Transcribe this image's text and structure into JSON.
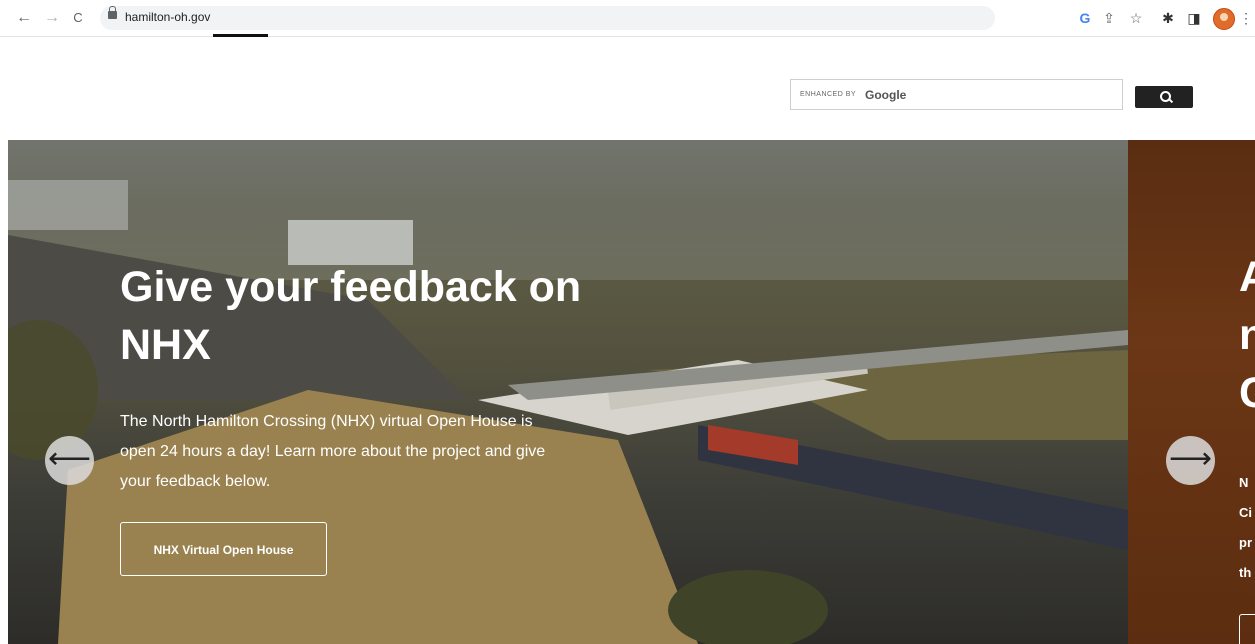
{
  "browser": {
    "url": "hamilton-oh.gov",
    "back_glyph": "←",
    "forward_glyph": "→",
    "reload_glyph": "C",
    "toolbar_icons": [
      "google-icon",
      "share-icon",
      "star-icon",
      "extensions-icon",
      "sidepanel-icon",
      "profile-avatar",
      "menu-icon"
    ],
    "google_glyph": "G",
    "share_glyph": "⇪",
    "star_glyph": "☆",
    "ext_glyph": "✱",
    "panel_glyph": "◨",
    "menu_glyph": "⋮"
  },
  "search": {
    "prefix": "ENHANCED BY",
    "brand": "Google"
  },
  "hero": {
    "title": "Give your feedback on NHX",
    "text": "The North Hamilton Crossing (NHX) virtual Open House is open 24 hours a day! Learn more about the project and give your feedback below.",
    "cta_label": "NHX Virtual Open House",
    "prev_glyph": "⟵",
    "next_glyph": "⟶"
  },
  "next_slide": {
    "title_lines": [
      "A",
      "n",
      "C"
    ],
    "text_lines": [
      "N",
      "Ci",
      "pr",
      "th"
    ]
  }
}
